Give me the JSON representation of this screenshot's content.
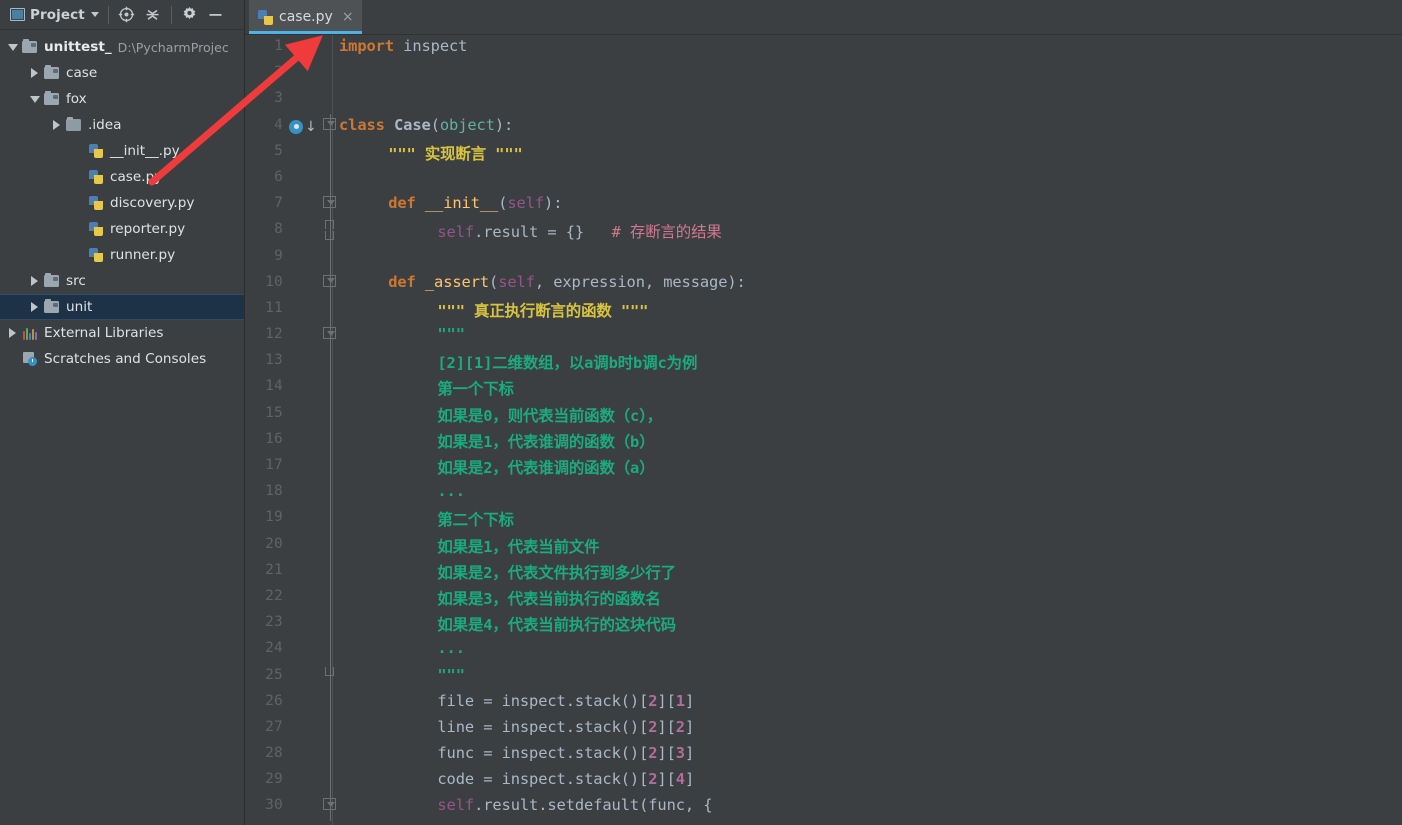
{
  "window": {
    "title": "case.py"
  },
  "toolwindow": {
    "title": "Project",
    "buttons": [
      {
        "name": "locate-icon",
        "tip": "Select Opened File"
      },
      {
        "name": "collapse-all-icon",
        "tip": "Collapse All"
      },
      {
        "name": "gear-icon",
        "tip": "Settings"
      },
      {
        "name": "minimize-icon",
        "tip": "Hide"
      }
    ]
  },
  "tree": {
    "items": [
      {
        "label": "unittest_",
        "sub": "D:\\PycharmProjec",
        "icon": "folder-icon",
        "arrow": "open",
        "indent": 0,
        "bold": true,
        "selected": false
      },
      {
        "label": "case",
        "sub": "",
        "icon": "folder-icon",
        "arrow": "closed",
        "indent": 1,
        "bold": false,
        "selected": false
      },
      {
        "label": "fox",
        "sub": "",
        "icon": "folder-icon",
        "arrow": "open",
        "indent": 1,
        "bold": false,
        "selected": false
      },
      {
        "label": ".idea",
        "sub": "",
        "icon": "folder-plain-icon",
        "arrow": "closed",
        "indent": 2,
        "bold": false,
        "selected": false
      },
      {
        "label": "__init__.py",
        "sub": "",
        "icon": "python-file-icon",
        "arrow": "none",
        "indent": 3,
        "bold": false,
        "selected": false
      },
      {
        "label": "case.py",
        "sub": "",
        "icon": "python-file-icon",
        "arrow": "none",
        "indent": 3,
        "bold": false,
        "selected": false
      },
      {
        "label": "discovery.py",
        "sub": "",
        "icon": "python-file-icon",
        "arrow": "none",
        "indent": 3,
        "bold": false,
        "selected": false
      },
      {
        "label": "reporter.py",
        "sub": "",
        "icon": "python-file-icon",
        "arrow": "none",
        "indent": 3,
        "bold": false,
        "selected": false
      },
      {
        "label": "runner.py",
        "sub": "",
        "icon": "python-file-icon",
        "arrow": "none",
        "indent": 3,
        "bold": false,
        "selected": false
      },
      {
        "label": "src",
        "sub": "",
        "icon": "folder-icon",
        "arrow": "closed",
        "indent": 1,
        "bold": false,
        "selected": false
      },
      {
        "label": "unit",
        "sub": "",
        "icon": "folder-icon",
        "arrow": "closed",
        "indent": 1,
        "bold": false,
        "selected": true
      },
      {
        "label": "External Libraries",
        "sub": "",
        "icon": "libraries-icon",
        "arrow": "closed",
        "indent": 0,
        "bold": false,
        "selected": false
      },
      {
        "label": "Scratches and Consoles",
        "sub": "",
        "icon": "scratches-icon",
        "arrow": "none",
        "indent": 0,
        "bold": false,
        "selected": false
      }
    ]
  },
  "tabs": [
    {
      "label": "case.py",
      "icon": "python-file-icon",
      "close": "×",
      "active": true
    }
  ],
  "editor": {
    "first_line": 1,
    "lines": [
      {
        "n": 1,
        "indent": 0,
        "tokens": [
          {
            "t": "import",
            "c": "k"
          },
          {
            "t": " inspect",
            "c": "id"
          }
        ]
      },
      {
        "n": 2,
        "indent": 0,
        "tokens": []
      },
      {
        "n": 3,
        "indent": 0,
        "tokens": []
      },
      {
        "n": 4,
        "indent": 0,
        "fold": "tri",
        "run": true,
        "tokens": [
          {
            "t": "class",
            "c": "k"
          },
          {
            "t": " ",
            "c": "id"
          },
          {
            "t": "Case",
            "c": "cls"
          },
          {
            "t": "(",
            "c": "punc"
          },
          {
            "t": "object",
            "c": "tealc"
          },
          {
            "t": ")",
            "c": "punc"
          },
          {
            "t": ":",
            "c": "punc"
          }
        ]
      },
      {
        "n": 5,
        "indent": 4,
        "tokens": [
          {
            "t": "\"\"\" 实现断言 \"\"\"",
            "c": "str-y"
          }
        ]
      },
      {
        "n": 6,
        "indent": 0,
        "tokens": []
      },
      {
        "n": 7,
        "indent": 4,
        "fold": "tri",
        "tokens": [
          {
            "t": "def",
            "c": "k"
          },
          {
            "t": " ",
            "c": "id"
          },
          {
            "t": "__init__",
            "c": "de"
          },
          {
            "t": "(",
            "c": "punc"
          },
          {
            "t": "self",
            "c": "slf"
          },
          {
            "t": ")",
            "c": "punc"
          },
          {
            "t": ":",
            "c": "punc"
          }
        ]
      },
      {
        "n": 8,
        "indent": 8,
        "fold": "caps",
        "tokens": [
          {
            "t": "self",
            "c": "slf"
          },
          {
            "t": ".result",
            "c": "id"
          },
          {
            "t": " = ",
            "c": "punc"
          },
          {
            "t": "{}",
            "c": "brk"
          },
          {
            "t": "   ",
            "c": "id"
          },
          {
            "t": "# 存断言的结果",
            "c": "cmt"
          }
        ]
      },
      {
        "n": 9,
        "indent": 0,
        "tokens": []
      },
      {
        "n": 10,
        "indent": 4,
        "fold": "tri",
        "tokens": [
          {
            "t": "def",
            "c": "k"
          },
          {
            "t": " ",
            "c": "id"
          },
          {
            "t": "_assert",
            "c": "de"
          },
          {
            "t": "(",
            "c": "punc"
          },
          {
            "t": "self",
            "c": "slf"
          },
          {
            "t": ", expression, message",
            "c": "id"
          },
          {
            "t": ")",
            "c": "punc"
          },
          {
            "t": ":",
            "c": "punc"
          }
        ]
      },
      {
        "n": 11,
        "indent": 8,
        "tokens": [
          {
            "t": "\"\"\" 真正执行断言的函数 \"\"\"",
            "c": "str-y"
          }
        ]
      },
      {
        "n": 12,
        "indent": 8,
        "fold": "tri",
        "tokens": [
          {
            "t": "\"\"\"",
            "c": "str-g"
          }
        ]
      },
      {
        "n": 13,
        "indent": 8,
        "tokens": [
          {
            "t": "[2][1]二维数组，以a调b时b调c为例",
            "c": "str-g"
          }
        ]
      },
      {
        "n": 14,
        "indent": 8,
        "tokens": [
          {
            "t": "第一个下标",
            "c": "str-g"
          }
        ]
      },
      {
        "n": 15,
        "indent": 8,
        "tokens": [
          {
            "t": "如果是0，则代表当前函数（c），",
            "c": "str-g"
          }
        ]
      },
      {
        "n": 16,
        "indent": 8,
        "tokens": [
          {
            "t": "如果是1，代表谁调的函数（b）",
            "c": "str-g"
          }
        ]
      },
      {
        "n": 17,
        "indent": 8,
        "tokens": [
          {
            "t": "如果是2，代表谁调的函数（a）",
            "c": "str-g"
          }
        ]
      },
      {
        "n": 18,
        "indent": 8,
        "tokens": [
          {
            "t": "...",
            "c": "str-g"
          }
        ]
      },
      {
        "n": 19,
        "indent": 8,
        "tokens": [
          {
            "t": "第二个下标",
            "c": "str-g"
          }
        ]
      },
      {
        "n": 20,
        "indent": 8,
        "tokens": [
          {
            "t": "如果是1，代表当前文件",
            "c": "str-g"
          }
        ]
      },
      {
        "n": 21,
        "indent": 8,
        "tokens": [
          {
            "t": "如果是2，代表文件执行到多少行了",
            "c": "str-g"
          }
        ]
      },
      {
        "n": 22,
        "indent": 8,
        "tokens": [
          {
            "t": "如果是3，代表当前执行的函数名",
            "c": "str-g"
          }
        ]
      },
      {
        "n": 23,
        "indent": 8,
        "tokens": [
          {
            "t": "如果是4，代表当前执行的这块代码",
            "c": "str-g"
          }
        ]
      },
      {
        "n": 24,
        "indent": 8,
        "tokens": [
          {
            "t": "...",
            "c": "str-g"
          }
        ]
      },
      {
        "n": 25,
        "indent": 8,
        "fold": "capB",
        "tokens": [
          {
            "t": "\"\"\"",
            "c": "str-g"
          }
        ]
      },
      {
        "n": 26,
        "indent": 8,
        "tokens": [
          {
            "t": "file",
            "c": "id"
          },
          {
            "t": " = ",
            "c": "punc"
          },
          {
            "t": "inspect",
            "c": "id"
          },
          {
            "t": ".stack",
            "c": "id"
          },
          {
            "t": "()",
            "c": "punc"
          },
          {
            "t": "[",
            "c": "punc"
          },
          {
            "t": "2",
            "c": "numpink"
          },
          {
            "t": "]",
            "c": "punc"
          },
          {
            "t": "[",
            "c": "punc"
          },
          {
            "t": "1",
            "c": "numpink"
          },
          {
            "t": "]",
            "c": "punc"
          }
        ]
      },
      {
        "n": 27,
        "indent": 8,
        "tokens": [
          {
            "t": "line",
            "c": "id"
          },
          {
            "t": " = ",
            "c": "punc"
          },
          {
            "t": "inspect",
            "c": "id"
          },
          {
            "t": ".stack",
            "c": "id"
          },
          {
            "t": "()",
            "c": "punc"
          },
          {
            "t": "[",
            "c": "punc"
          },
          {
            "t": "2",
            "c": "numpink"
          },
          {
            "t": "]",
            "c": "punc"
          },
          {
            "t": "[",
            "c": "punc"
          },
          {
            "t": "2",
            "c": "numpink"
          },
          {
            "t": "]",
            "c": "punc"
          }
        ]
      },
      {
        "n": 28,
        "indent": 8,
        "tokens": [
          {
            "t": "func",
            "c": "id"
          },
          {
            "t": " = ",
            "c": "punc"
          },
          {
            "t": "inspect",
            "c": "id"
          },
          {
            "t": ".stack",
            "c": "id"
          },
          {
            "t": "()",
            "c": "punc"
          },
          {
            "t": "[",
            "c": "punc"
          },
          {
            "t": "2",
            "c": "numpink"
          },
          {
            "t": "]",
            "c": "punc"
          },
          {
            "t": "[",
            "c": "punc"
          },
          {
            "t": "3",
            "c": "numpink"
          },
          {
            "t": "]",
            "c": "punc"
          }
        ]
      },
      {
        "n": 29,
        "indent": 8,
        "tokens": [
          {
            "t": "code",
            "c": "id"
          },
          {
            "t": " = ",
            "c": "punc"
          },
          {
            "t": "inspect",
            "c": "id"
          },
          {
            "t": ".stack",
            "c": "id"
          },
          {
            "t": "()",
            "c": "punc"
          },
          {
            "t": "[",
            "c": "punc"
          },
          {
            "t": "2",
            "c": "numpink"
          },
          {
            "t": "]",
            "c": "punc"
          },
          {
            "t": "[",
            "c": "punc"
          },
          {
            "t": "4",
            "c": "numpink"
          },
          {
            "t": "]",
            "c": "punc"
          }
        ]
      },
      {
        "n": 30,
        "indent": 8,
        "fold": "tri",
        "tokens": [
          {
            "t": "self",
            "c": "slf"
          },
          {
            "t": ".result.setdefault",
            "c": "id"
          },
          {
            "t": "(",
            "c": "punc"
          },
          {
            "t": "func",
            "c": "id"
          },
          {
            "t": ", ",
            "c": "punc"
          },
          {
            "t": "{",
            "c": "brk"
          }
        ]
      }
    ]
  },
  "annotation": {
    "arrow_color": "#ef3b3b",
    "name": "red-arrow-pointing-to-tab"
  },
  "colors": {
    "background": "#3c3f41",
    "panel": "#3c3f41",
    "selection": "#1d3247",
    "tab_active": "#4e5254",
    "tab_underline": "#4db2e5",
    "keyword": "#cc7832",
    "string_yellow": "#d8c441",
    "string_green": "#1aab7f",
    "comment": "#d0788f",
    "self": "#94558d",
    "number": "#b36c9c",
    "function": "#ffc66d",
    "builtin": "#5fb3a1",
    "line_number": "#606366"
  }
}
